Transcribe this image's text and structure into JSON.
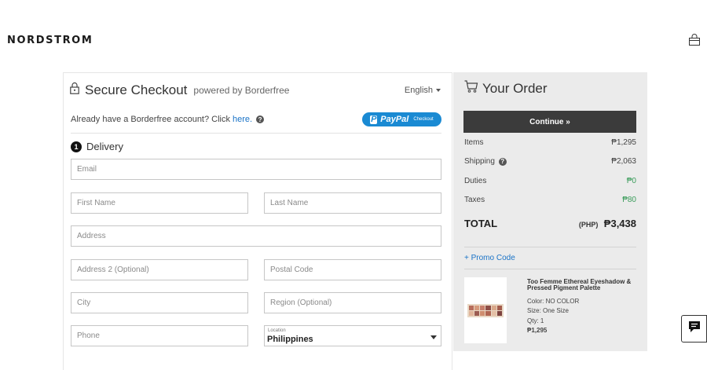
{
  "header": {
    "brand": "NORDSTROM",
    "bag_icon": "shopping-bag-icon"
  },
  "checkout": {
    "title": "Secure Checkout",
    "powered_by": "powered by Borderfree",
    "language": "English",
    "account_prompt": "Already have a Borderfree account? Click",
    "account_link": "here.",
    "paypal_word": "PayPal",
    "paypal_sub": "Checkout",
    "paypal_p": "P",
    "step_number": "1",
    "section_title": "Delivery",
    "fields": {
      "email": "Email",
      "first_name": "First Name",
      "last_name": "Last Name",
      "address": "Address",
      "address2": "Address 2 (Optional)",
      "postal": "Postal Code",
      "city": "City",
      "region": "Region (Optional)",
      "phone": "Phone"
    },
    "location": {
      "label": "Location",
      "value": "Philippines"
    }
  },
  "order": {
    "title": "Your Order",
    "continue_label": "Continue »",
    "rows": [
      {
        "label": "Items",
        "value": "₱1,295"
      },
      {
        "label": "Shipping",
        "value": "₱2,063"
      },
      {
        "label": "Duties",
        "value": "₱0"
      },
      {
        "label": "Taxes",
        "value": "₱80"
      }
    ],
    "total_label": "TOTAL",
    "total_currency": "(PHP)",
    "total_value": "₱3,438",
    "promo": "+ Promo Code",
    "product": {
      "name": "Too Femme Ethereal Eyeshadow & Pressed Pigment Palette",
      "color": "Color: NO COLOR",
      "size": "Size: One Size",
      "qty": "Qty: 1",
      "price": "₱1,295"
    }
  },
  "colors": {
    "accent_link": "#1a73c7",
    "paypal_blue": "#1a8ad3",
    "green": "#3a9c5a",
    "button_dark": "#3b3b3b"
  }
}
